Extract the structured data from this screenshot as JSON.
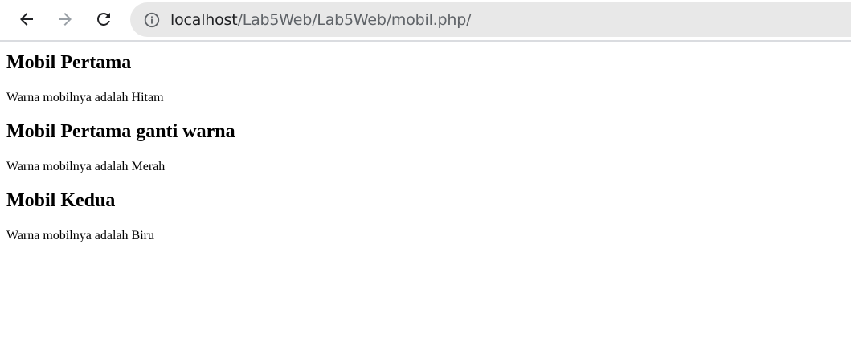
{
  "browser": {
    "url_host": "localhost",
    "url_path": "/Lab5Web/Lab5Web/mobil.php/"
  },
  "sections": [
    {
      "heading": "Mobil Pertama",
      "text": "Warna mobilnya adalah Hitam"
    },
    {
      "heading": "Mobil Pertama ganti warna",
      "text": "Warna mobilnya adalah Merah"
    },
    {
      "heading": "Mobil Kedua",
      "text": "Warna mobilnya adalah Biru"
    }
  ]
}
